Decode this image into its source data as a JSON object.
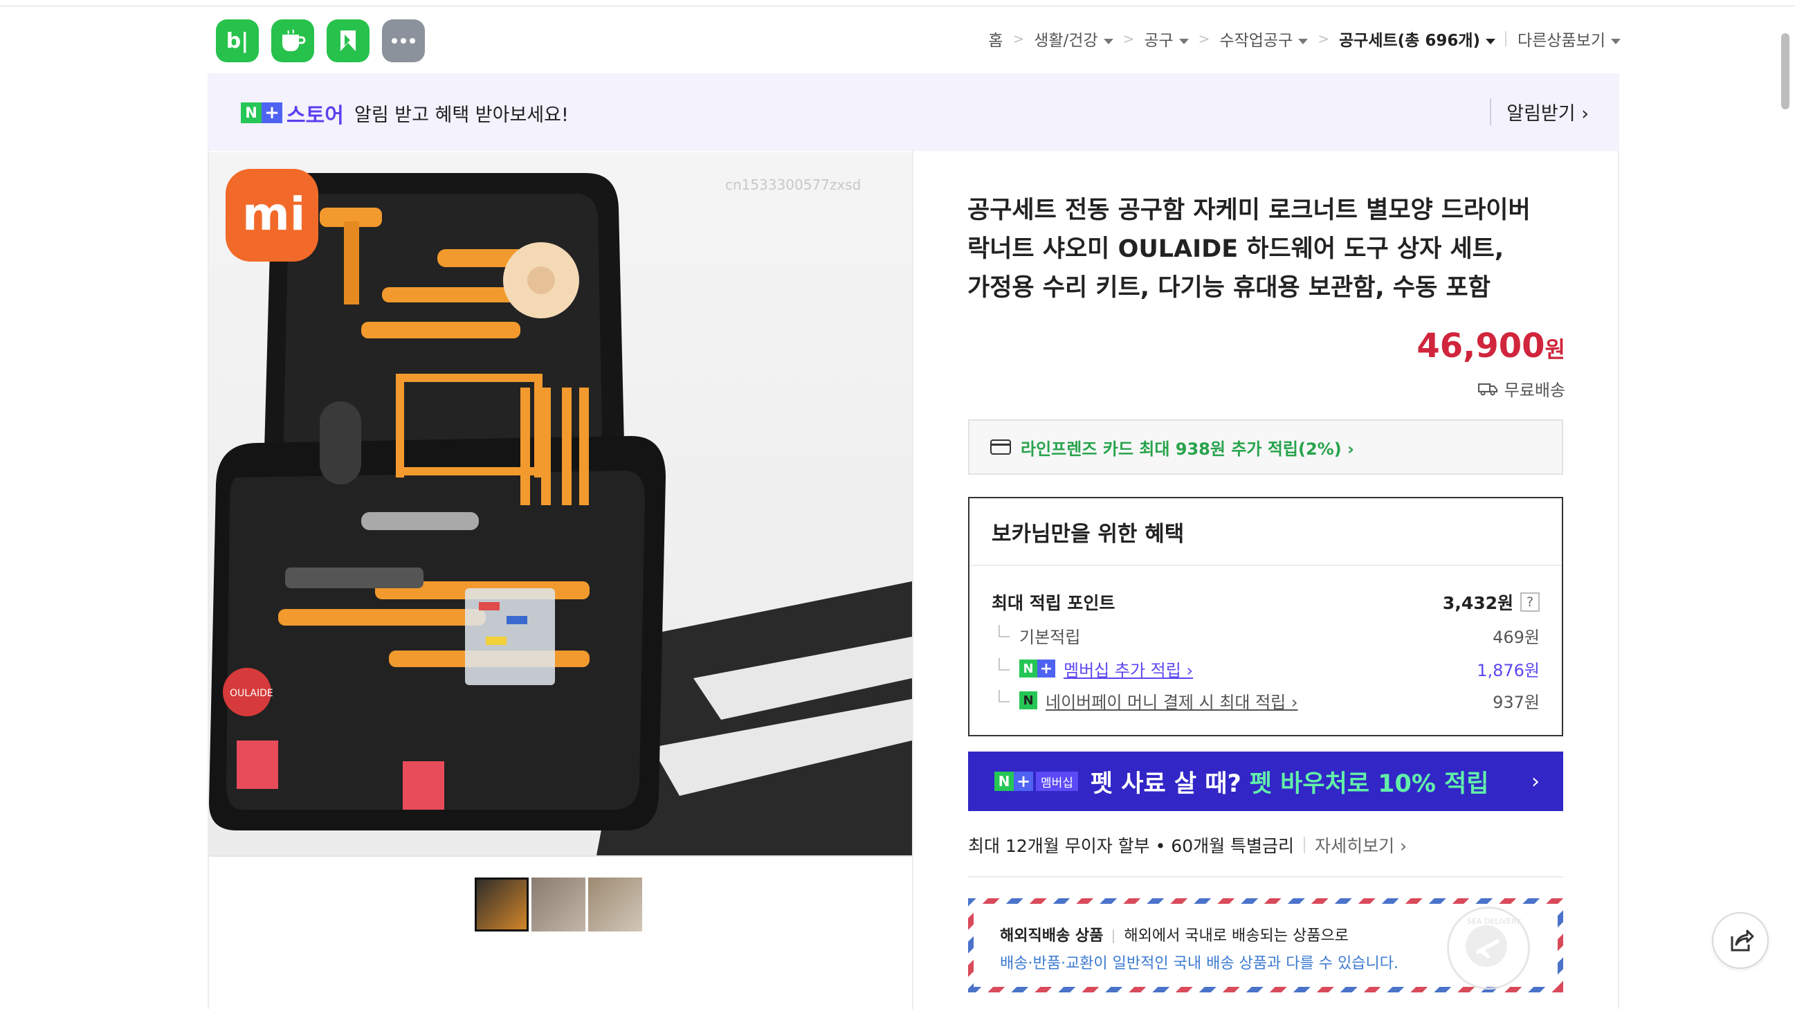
{
  "header": {
    "app_icons": [
      "blog-icon",
      "cafe-icon",
      "bookmark-icon",
      "more-icon"
    ],
    "app_icon_labels": {
      "blog": "b|"
    },
    "breadcrumb": [
      {
        "label": "홈",
        "dropdown": false
      },
      {
        "label": "생활/건강",
        "dropdown": true
      },
      {
        "label": "공구",
        "dropdown": true
      },
      {
        "label": "수작업공구",
        "dropdown": true
      },
      {
        "label": "공구세트(총 696개)",
        "dropdown": true,
        "current": true
      }
    ],
    "other_products": "다른상품보기"
  },
  "store_bar": {
    "badge_n": "N",
    "badge_plus": "+",
    "store_name": "스토어",
    "message": "알림 받고 혜택 받아보세요!",
    "alarm_button": "알림받기 ›"
  },
  "image": {
    "brand_logo": "mi",
    "watermark": "cn1533300577zxsd",
    "box_label": "OULAIDE",
    "thumbnail_count": 3,
    "selected_thumbnail": 0
  },
  "product": {
    "title": "공구세트 전동 공구함 자케미 로크너트 별모양 드라이버 락너트 샤오미 OULAIDE 하드웨어 도구 상자 세트, 가정용 수리 키트, 다기능 휴대용 보관함, 수동 포함",
    "price": "46,900",
    "currency": "원",
    "shipping": "무료배송",
    "card_offer": "라인프렌즈 카드 최대 938원 추가 적립(2%) ›"
  },
  "benefits": {
    "heading": "보카님만을 위한 혜택",
    "max_points_label": "최대 적립 포인트",
    "max_points_value": "3,432원",
    "help": "?",
    "rows": [
      {
        "label": "기본적립",
        "value": "469원"
      },
      {
        "label": "멤버십 추가 적립 ›",
        "value": "1,876원"
      },
      {
        "label": "네이버페이 머니 결제 시 최대 적립 ›",
        "value": "937원"
      }
    ]
  },
  "membership_banner": {
    "badge_n": "N",
    "badge_plus": "+",
    "badge_text": "멤버십",
    "text": "펫 사료 살 때?",
    "highlight": "펫 바우처로 10% 적립",
    "chevron": "›"
  },
  "installment": {
    "text": "최대 12개월 무이자 할부 • 60개월 특별금리",
    "more": "자세히보기 ›"
  },
  "overseas": {
    "label": "해외직배송 상품",
    "desc": "해외에서 국내로 배송되는 상품으로",
    "note": "배송·반품·교환이 일반적인 국내 배송 상품과 다를 수 있습니다.",
    "stamp_text": "SEA DELIVERY"
  },
  "share_icon": "share-icon",
  "colors": {
    "accent_green": "#25c656",
    "price_red": "#d0253c",
    "membership_blue": "#3226c7",
    "store_purple": "#5b3ff0"
  }
}
